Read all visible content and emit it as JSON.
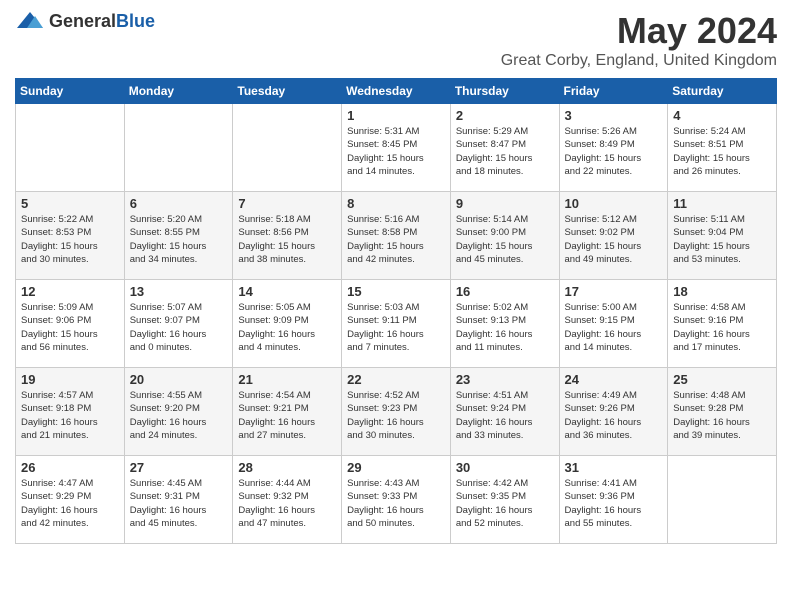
{
  "header": {
    "logo_general": "General",
    "logo_blue": "Blue",
    "month_title": "May 2024",
    "location": "Great Corby, England, United Kingdom"
  },
  "days_of_week": [
    "Sunday",
    "Monday",
    "Tuesday",
    "Wednesday",
    "Thursday",
    "Friday",
    "Saturday"
  ],
  "weeks": [
    [
      {
        "day": "",
        "info": ""
      },
      {
        "day": "",
        "info": ""
      },
      {
        "day": "",
        "info": ""
      },
      {
        "day": "1",
        "info": "Sunrise: 5:31 AM\nSunset: 8:45 PM\nDaylight: 15 hours\nand 14 minutes."
      },
      {
        "day": "2",
        "info": "Sunrise: 5:29 AM\nSunset: 8:47 PM\nDaylight: 15 hours\nand 18 minutes."
      },
      {
        "day": "3",
        "info": "Sunrise: 5:26 AM\nSunset: 8:49 PM\nDaylight: 15 hours\nand 22 minutes."
      },
      {
        "day": "4",
        "info": "Sunrise: 5:24 AM\nSunset: 8:51 PM\nDaylight: 15 hours\nand 26 minutes."
      }
    ],
    [
      {
        "day": "5",
        "info": "Sunrise: 5:22 AM\nSunset: 8:53 PM\nDaylight: 15 hours\nand 30 minutes."
      },
      {
        "day": "6",
        "info": "Sunrise: 5:20 AM\nSunset: 8:55 PM\nDaylight: 15 hours\nand 34 minutes."
      },
      {
        "day": "7",
        "info": "Sunrise: 5:18 AM\nSunset: 8:56 PM\nDaylight: 15 hours\nand 38 minutes."
      },
      {
        "day": "8",
        "info": "Sunrise: 5:16 AM\nSunset: 8:58 PM\nDaylight: 15 hours\nand 42 minutes."
      },
      {
        "day": "9",
        "info": "Sunrise: 5:14 AM\nSunset: 9:00 PM\nDaylight: 15 hours\nand 45 minutes."
      },
      {
        "day": "10",
        "info": "Sunrise: 5:12 AM\nSunset: 9:02 PM\nDaylight: 15 hours\nand 49 minutes."
      },
      {
        "day": "11",
        "info": "Sunrise: 5:11 AM\nSunset: 9:04 PM\nDaylight: 15 hours\nand 53 minutes."
      }
    ],
    [
      {
        "day": "12",
        "info": "Sunrise: 5:09 AM\nSunset: 9:06 PM\nDaylight: 15 hours\nand 56 minutes."
      },
      {
        "day": "13",
        "info": "Sunrise: 5:07 AM\nSunset: 9:07 PM\nDaylight: 16 hours\nand 0 minutes."
      },
      {
        "day": "14",
        "info": "Sunrise: 5:05 AM\nSunset: 9:09 PM\nDaylight: 16 hours\nand 4 minutes."
      },
      {
        "day": "15",
        "info": "Sunrise: 5:03 AM\nSunset: 9:11 PM\nDaylight: 16 hours\nand 7 minutes."
      },
      {
        "day": "16",
        "info": "Sunrise: 5:02 AM\nSunset: 9:13 PM\nDaylight: 16 hours\nand 11 minutes."
      },
      {
        "day": "17",
        "info": "Sunrise: 5:00 AM\nSunset: 9:15 PM\nDaylight: 16 hours\nand 14 minutes."
      },
      {
        "day": "18",
        "info": "Sunrise: 4:58 AM\nSunset: 9:16 PM\nDaylight: 16 hours\nand 17 minutes."
      }
    ],
    [
      {
        "day": "19",
        "info": "Sunrise: 4:57 AM\nSunset: 9:18 PM\nDaylight: 16 hours\nand 21 minutes."
      },
      {
        "day": "20",
        "info": "Sunrise: 4:55 AM\nSunset: 9:20 PM\nDaylight: 16 hours\nand 24 minutes."
      },
      {
        "day": "21",
        "info": "Sunrise: 4:54 AM\nSunset: 9:21 PM\nDaylight: 16 hours\nand 27 minutes."
      },
      {
        "day": "22",
        "info": "Sunrise: 4:52 AM\nSunset: 9:23 PM\nDaylight: 16 hours\nand 30 minutes."
      },
      {
        "day": "23",
        "info": "Sunrise: 4:51 AM\nSunset: 9:24 PM\nDaylight: 16 hours\nand 33 minutes."
      },
      {
        "day": "24",
        "info": "Sunrise: 4:49 AM\nSunset: 9:26 PM\nDaylight: 16 hours\nand 36 minutes."
      },
      {
        "day": "25",
        "info": "Sunrise: 4:48 AM\nSunset: 9:28 PM\nDaylight: 16 hours\nand 39 minutes."
      }
    ],
    [
      {
        "day": "26",
        "info": "Sunrise: 4:47 AM\nSunset: 9:29 PM\nDaylight: 16 hours\nand 42 minutes."
      },
      {
        "day": "27",
        "info": "Sunrise: 4:45 AM\nSunset: 9:31 PM\nDaylight: 16 hours\nand 45 minutes."
      },
      {
        "day": "28",
        "info": "Sunrise: 4:44 AM\nSunset: 9:32 PM\nDaylight: 16 hours\nand 47 minutes."
      },
      {
        "day": "29",
        "info": "Sunrise: 4:43 AM\nSunset: 9:33 PM\nDaylight: 16 hours\nand 50 minutes."
      },
      {
        "day": "30",
        "info": "Sunrise: 4:42 AM\nSunset: 9:35 PM\nDaylight: 16 hours\nand 52 minutes."
      },
      {
        "day": "31",
        "info": "Sunrise: 4:41 AM\nSunset: 9:36 PM\nDaylight: 16 hours\nand 55 minutes."
      },
      {
        "day": "",
        "info": ""
      }
    ]
  ]
}
